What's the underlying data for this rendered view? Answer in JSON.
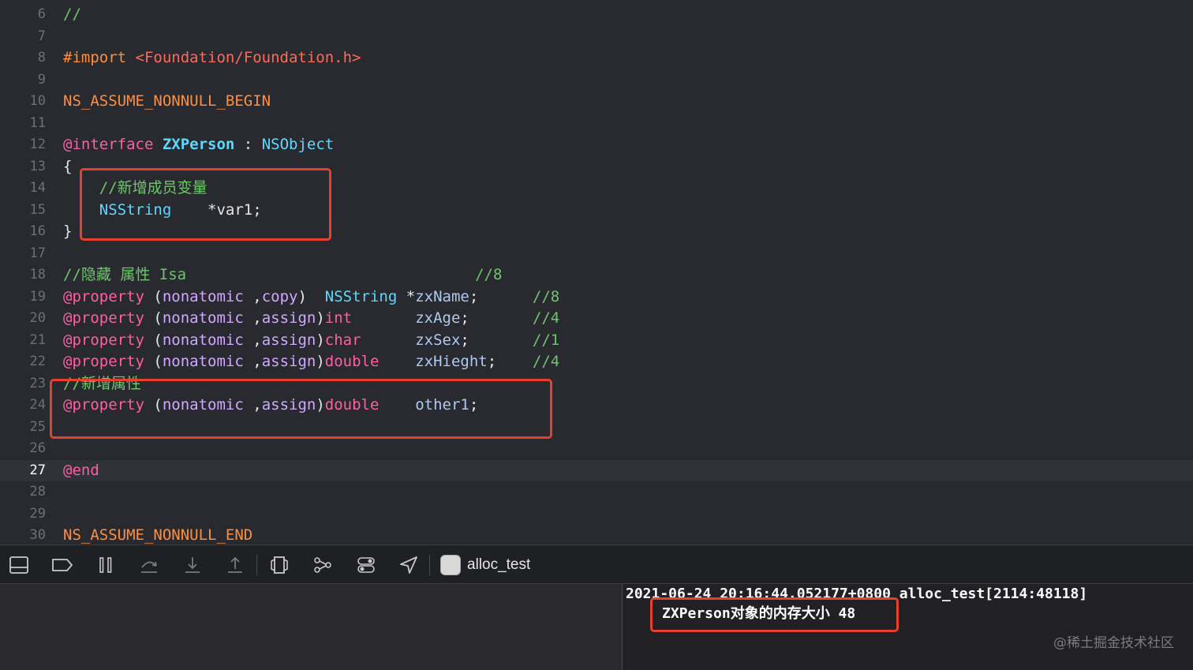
{
  "editor": {
    "current_line": "27",
    "lines": [
      {
        "num": "6",
        "tokens": [
          {
            "t": "//",
            "c": "cm"
          }
        ]
      },
      {
        "num": "7",
        "tokens": []
      },
      {
        "num": "8",
        "tokens": [
          {
            "t": "#import ",
            "c": "macro"
          },
          {
            "t": "<Foundation/Foundation.h>",
            "c": "str"
          }
        ]
      },
      {
        "num": "9",
        "tokens": []
      },
      {
        "num": "10",
        "tokens": [
          {
            "t": "NS_ASSUME_NONNULL_BEGIN",
            "c": "macro"
          }
        ]
      },
      {
        "num": "11",
        "tokens": []
      },
      {
        "num": "12",
        "tokens": [
          {
            "t": "@interface ",
            "c": "kw"
          },
          {
            "t": "ZXPerson",
            "c": "cls"
          },
          {
            "t": " : ",
            "c": "pl"
          },
          {
            "t": "NSObject",
            "c": "typ"
          }
        ]
      },
      {
        "num": "13",
        "tokens": [
          {
            "t": "{",
            "c": "pl"
          }
        ]
      },
      {
        "num": "14",
        "tokens": [
          {
            "t": "    //新增成员变量",
            "c": "cm"
          }
        ]
      },
      {
        "num": "15",
        "tokens": [
          {
            "t": "    ",
            "c": "pl"
          },
          {
            "t": "NSString",
            "c": "typ"
          },
          {
            "t": "    *var1;",
            "c": "pl"
          }
        ]
      },
      {
        "num": "16",
        "tokens": [
          {
            "t": "}",
            "c": "pl"
          }
        ]
      },
      {
        "num": "17",
        "tokens": []
      },
      {
        "num": "18",
        "tokens": [
          {
            "t": "//隐藏 属性 Isa                                //8",
            "c": "cm"
          }
        ]
      },
      {
        "num": "19",
        "tokens": [
          {
            "t": "@property ",
            "c": "kw"
          },
          {
            "t": "(",
            "c": "pl"
          },
          {
            "t": "nonatomic",
            "c": "attr"
          },
          {
            "t": " ,",
            "c": "pl"
          },
          {
            "t": "copy",
            "c": "attr"
          },
          {
            "t": ")  ",
            "c": "pl"
          },
          {
            "t": "NSString",
            "c": "typ"
          },
          {
            "t": " *",
            "c": "pl"
          },
          {
            "t": "zxName",
            "c": "prop"
          },
          {
            "t": ";      ",
            "c": "pl"
          },
          {
            "t": "//8",
            "c": "cm"
          }
        ]
      },
      {
        "num": "20",
        "tokens": [
          {
            "t": "@property ",
            "c": "kw"
          },
          {
            "t": "(",
            "c": "pl"
          },
          {
            "t": "nonatomic",
            "c": "attr"
          },
          {
            "t": " ,",
            "c": "pl"
          },
          {
            "t": "assign",
            "c": "attr"
          },
          {
            "t": ")",
            "c": "pl"
          },
          {
            "t": "int",
            "c": "kw"
          },
          {
            "t": "       ",
            "c": "pl"
          },
          {
            "t": "zxAge",
            "c": "prop"
          },
          {
            "t": ";       ",
            "c": "pl"
          },
          {
            "t": "//4",
            "c": "cm"
          }
        ]
      },
      {
        "num": "21",
        "tokens": [
          {
            "t": "@property ",
            "c": "kw"
          },
          {
            "t": "(",
            "c": "pl"
          },
          {
            "t": "nonatomic",
            "c": "attr"
          },
          {
            "t": " ,",
            "c": "pl"
          },
          {
            "t": "assign",
            "c": "attr"
          },
          {
            "t": ")",
            "c": "pl"
          },
          {
            "t": "char",
            "c": "kw"
          },
          {
            "t": "      ",
            "c": "pl"
          },
          {
            "t": "zxSex",
            "c": "prop"
          },
          {
            "t": ";       ",
            "c": "pl"
          },
          {
            "t": "//1",
            "c": "cm"
          }
        ]
      },
      {
        "num": "22",
        "tokens": [
          {
            "t": "@property ",
            "c": "kw"
          },
          {
            "t": "(",
            "c": "pl"
          },
          {
            "t": "nonatomic",
            "c": "attr"
          },
          {
            "t": " ,",
            "c": "pl"
          },
          {
            "t": "assign",
            "c": "attr"
          },
          {
            "t": ")",
            "c": "pl"
          },
          {
            "t": "double",
            "c": "kw"
          },
          {
            "t": "    ",
            "c": "pl"
          },
          {
            "t": "zxHieght",
            "c": "prop"
          },
          {
            "t": ";    ",
            "c": "pl"
          },
          {
            "t": "//4",
            "c": "cm"
          }
        ]
      },
      {
        "num": "23",
        "tokens": [
          {
            "t": "//新增属性",
            "c": "cm"
          }
        ]
      },
      {
        "num": "24",
        "tokens": [
          {
            "t": "@property ",
            "c": "kw"
          },
          {
            "t": "(",
            "c": "pl"
          },
          {
            "t": "nonatomic",
            "c": "attr"
          },
          {
            "t": " ,",
            "c": "pl"
          },
          {
            "t": "assign",
            "c": "attr"
          },
          {
            "t": ")",
            "c": "pl"
          },
          {
            "t": "double",
            "c": "kw"
          },
          {
            "t": "    ",
            "c": "pl"
          },
          {
            "t": "other1",
            "c": "prop"
          },
          {
            "t": ";",
            "c": "pl"
          }
        ]
      },
      {
        "num": "25",
        "tokens": []
      },
      {
        "num": "26",
        "tokens": []
      },
      {
        "num": "27",
        "tokens": [
          {
            "t": "@end",
            "c": "kw"
          }
        ]
      },
      {
        "num": "28",
        "tokens": []
      },
      {
        "num": "29",
        "tokens": []
      },
      {
        "num": "30",
        "tokens": [
          {
            "t": "NS_ASSUME_NONNULL_END",
            "c": "macro"
          }
        ]
      }
    ]
  },
  "debug_bar": {
    "icons": [
      "hide-debug-area-icon",
      "breakpoints-toggle-icon",
      "pause-icon",
      "step-over-icon",
      "step-into-icon",
      "step-out-icon",
      "view-hierarchy-icon",
      "memory-graph-icon",
      "environment-overrides-icon",
      "simulate-location-icon"
    ],
    "target_label": "alloc_test"
  },
  "console": {
    "line1": "2021-06-24 20:16:44.052177+0800 alloc_test[2114:48118]",
    "line2": "ZXPerson对象的内存大小 48",
    "watermark": "@稀土掘金技术社区"
  },
  "colors": {
    "highlight_box": "#e8402d",
    "keyword": "#fc5fa3",
    "comment": "#6ec56b",
    "type": "#5dd8ff",
    "string": "#fc6a5d",
    "preprocessor": "#fd8f3f",
    "editor_background": "#292a30"
  }
}
